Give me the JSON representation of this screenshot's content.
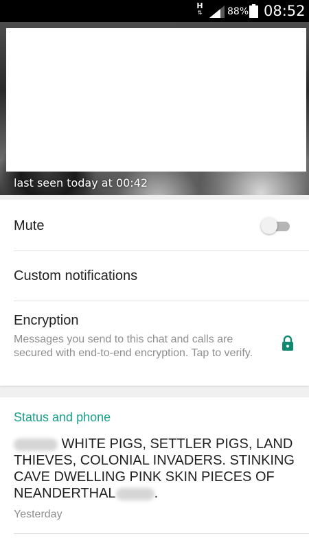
{
  "status_bar": {
    "network_type": "H",
    "battery_percent": "88%",
    "time": "08:52"
  },
  "header": {
    "last_seen": "last seen today at 00:42"
  },
  "settings": {
    "mute": {
      "label": "Mute",
      "enabled": false
    },
    "custom_notifications": {
      "label": "Custom notifications"
    },
    "encryption": {
      "label": "Encryption",
      "description": "Messages you send to this chat and calls are secured with end-to-end encryption. Tap to verify.",
      "icon": "lock-icon"
    }
  },
  "status_section": {
    "title": "Status and phone",
    "status_text_part1": "WHITE PIGS, SETTLER PIGS, LAND THIEVES, COLONIAL INVADERS. STINKING CAVE DWELLING PINK SKIN PIECES OF NEANDERTHAL",
    "status_text_end": ".",
    "time": "Yesterday"
  },
  "colors": {
    "accent": "#1a9e8a",
    "lock": "#0f8a6e",
    "text_primary": "#212121",
    "text_secondary": "#8e8e8e"
  }
}
